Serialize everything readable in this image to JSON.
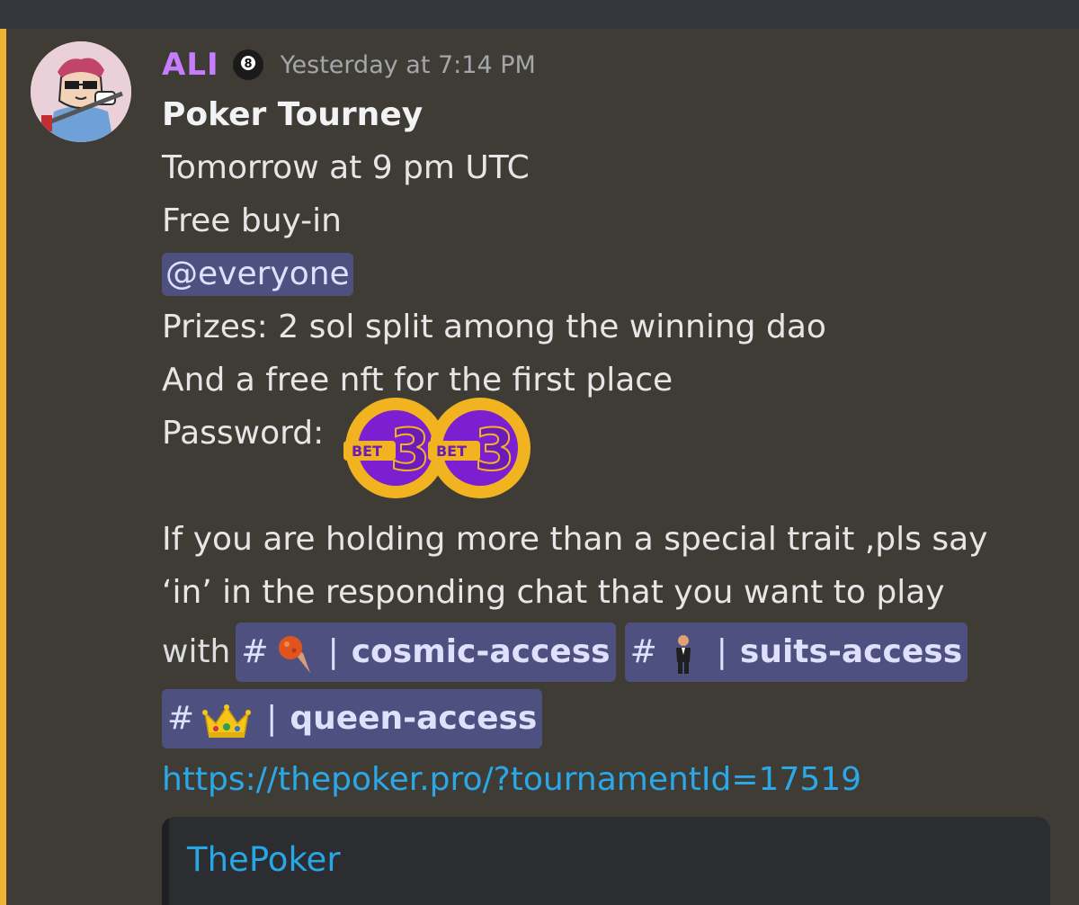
{
  "message": {
    "author": "ALI",
    "author_color": "#c77dff",
    "badge_icon": "8-ball-icon",
    "timestamp": "Yesterday at 7:14 PM",
    "title": "Poker Tourney",
    "lines": [
      "Tomorrow at 9 pm UTC",
      "Free buy-in"
    ],
    "mention": "@everyone",
    "lines2": [
      "Prizes: 2 sol split among the winning dao",
      "And a free nft for the first place"
    ],
    "password_label": "Password: ",
    "sticker_text": [
      "BET",
      "3",
      "BET",
      "3"
    ],
    "lines3": [
      "If you are holding more than a special trait ,pls say",
      "‘in’ in the responding chat that you want to play"
    ],
    "with_label": "with",
    "channels": [
      {
        "hash": "#",
        "emoji": "comet-icon",
        "sep": "|",
        "name": "cosmic-access"
      },
      {
        "hash": "#",
        "emoji": "man-in-suit-icon",
        "sep": "|",
        "name": "suits-access"
      },
      {
        "hash": "#",
        "emoji": "crown-icon",
        "sep": "|",
        "name": "queen-access"
      }
    ],
    "link": "https://thepoker.pro/?tournamentId=17519"
  },
  "embed": {
    "provider": "ThePoker"
  },
  "colors": {
    "background": "#3f3c36",
    "highlight": "#f0b232",
    "mention_bg": "#4e5180",
    "link": "#2aa8e8"
  }
}
